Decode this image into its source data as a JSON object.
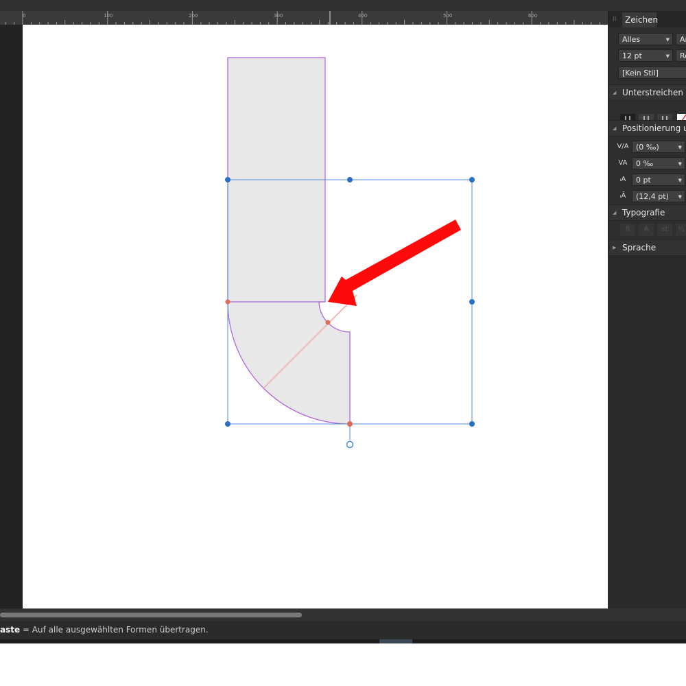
{
  "ruler": {
    "labels": [
      "0",
      "100",
      "200",
      "300",
      "400",
      "500",
      "600"
    ]
  },
  "panel": {
    "tab_label": "Zeichen",
    "font_collection": "Alles",
    "font_family": "Ar",
    "font_size": "12 pt",
    "font_style": "Re",
    "paragraph_style": "[Kein Stil]",
    "sections": {
      "underline": "Unterstreichen un",
      "positioning": "Positionierung un",
      "typography": "Typografie",
      "language": "Sprache"
    },
    "underline_buttons": [
      "U",
      "U",
      "U"
    ],
    "positioning": {
      "kerning": "(0 ‰)",
      "tracking": "0 ‰",
      "baseline": "0 pt",
      "leading": "(12,4 pt)"
    }
  },
  "status": {
    "key_label": "aste",
    "hint": " = Auf alle ausgewählten Formen übertragen."
  },
  "colors": {
    "shape_fill": "#e8e8e8",
    "shape_stroke": "#b066d6",
    "selection": "#4a8ed8",
    "handle": "#2d6ec9",
    "node": "#e06a5a",
    "arrow": "#ff0a0a",
    "guide": "#f0b8b0"
  }
}
